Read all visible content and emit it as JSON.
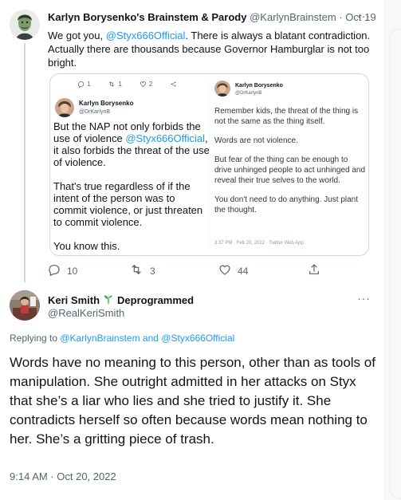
{
  "tweet1": {
    "name": "Karlyn Borysenko's Brainstem & Parody",
    "handle": "@KarlynBrainstem",
    "separator": "·",
    "date": "Oct 19",
    "text_before": "We got you, ",
    "text_mention": "@Styx666Official",
    "text_after": ". There is always a blatant contradiction. Actually there are thousands because Governor Hamburglar is not too bright.",
    "quote": {
      "mini_reply_count": "1",
      "mini_retweet_count": "1",
      "mini_like_count": "2",
      "left": {
        "name": "Karlyn Borysenko",
        "handle": "@DrKarlynB",
        "p1_before": "But the NAP not only forbids the use of violence ",
        "p1_mention": "@Styx666Official",
        "p1_after": ", it also forbids the threat of the use of violence.",
        "p2": "That's true regardless of if the intent of the person was to commit violence, or just threaten to commit violence.",
        "p3": "You know this."
      },
      "right": {
        "name": "Karlyn Borysenko",
        "handle": "@DrKarlynB",
        "p1": "Remember kids, the threat of the thing is not the same as the thing itself.",
        "p2": "Words are not violence.",
        "p3": "But fear of the thing can be enough to drive unhinged people to act unhinged and reveal their true selves to the world.",
        "p4": "You don't need to do anything. Just plant the thought.",
        "meta": "3:37 PM · Feb 20, 2022 · Twitter Web App"
      }
    },
    "actions": {
      "reply_count": "10",
      "retweet_count": "3",
      "like_count": "44"
    }
  },
  "tweet2": {
    "name": "Keri Smith",
    "badge": "Deprogrammed",
    "handle": "@RealKeriSmith",
    "replying_prefix": "Replying to ",
    "replying_user1": "@KarlynBrainstem",
    "replying_and": " and ",
    "replying_user2": "@Styx666Official",
    "body": "Words have no meaning to this person, other than as tools of manipulation. She outright admitted in her attacks on Styx that she’s a liar who lies and she tried to justify it. She contradicts herself so often because words mean nothing to her. She’s a gritting piece of trash.",
    "timestamp": "9:14 AM · Oct 20, 2022"
  },
  "colors": {
    "accent": "#1d9bf0",
    "muted": "#536471",
    "border": "#cfd9de",
    "sprout": "#4caf50"
  },
  "icons": [
    "more-icon",
    "reply-icon",
    "retweet-icon",
    "like-icon",
    "share-icon",
    "sprout-icon"
  ]
}
